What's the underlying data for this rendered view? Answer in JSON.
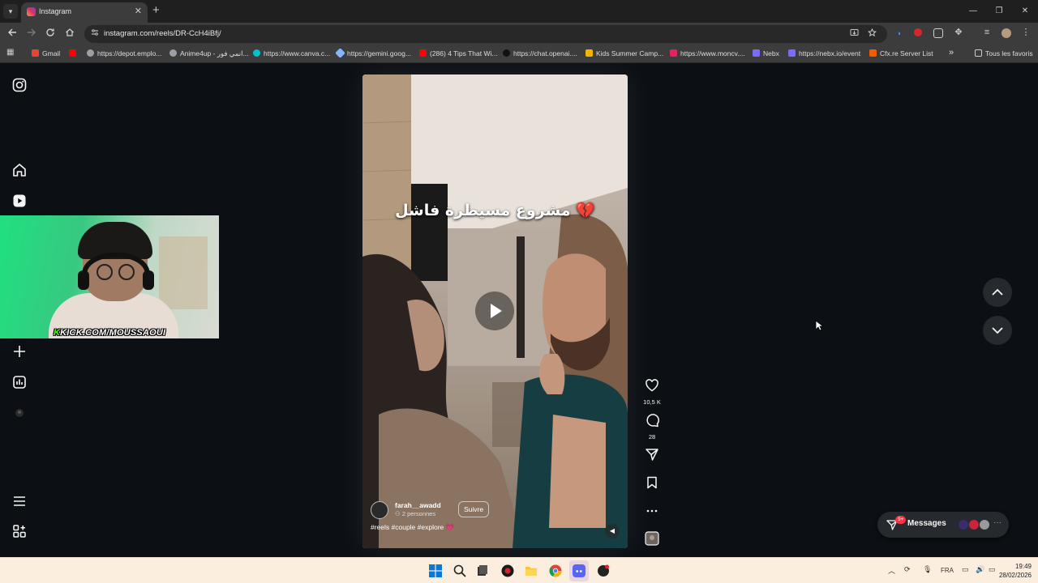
{
  "browser": {
    "tab": {
      "title": "Instagram",
      "close": "✕"
    },
    "new_tab": "+",
    "window_controls": [
      "—",
      "❐",
      "✕"
    ],
    "url": "instagram.com/reels/DR-CcH4iBfj/",
    "bookmarks": [
      {
        "label": "Gmail",
        "icon": "gmail-icon",
        "color": "#ea4335"
      },
      {
        "label": "",
        "icon": "youtube-icon",
        "color": "#ff0000"
      },
      {
        "label": "https://depot.emplo...",
        "icon": "globe-icon",
        "color": "#9aa0a6"
      },
      {
        "label": "Anime4up - انمي فور...",
        "icon": "globe-icon",
        "color": "#9aa0a6"
      },
      {
        "label": "https://www.canva.c...",
        "icon": "canva-icon",
        "color": "#00c4cc"
      },
      {
        "label": "https://gemini.goog...",
        "icon": "gemini-icon",
        "color": "#8ab4f8"
      },
      {
        "label": "(286) 4 Tips That Wi...",
        "icon": "youtube-icon",
        "color": "#ff0000"
      },
      {
        "label": "https://chat.openai....",
        "icon": "openai-icon",
        "color": "#111111"
      },
      {
        "label": "Kids Summer Camp...",
        "icon": "camp-icon",
        "color": "#f4b400"
      },
      {
        "label": "https://www.moncv....",
        "icon": "moncv-icon",
        "color": "#e0245e"
      },
      {
        "label": "Nebx",
        "icon": "nebx-icon",
        "color": "#7b6cf6"
      },
      {
        "label": "https://nebx.io/event",
        "icon": "nebx-icon",
        "color": "#7b6cf6"
      },
      {
        "label": "Cfx.re Server List",
        "icon": "cfx-icon",
        "color": "#f25c05"
      }
    ],
    "bookmarks_overflow": "»",
    "all_bookmarks": "Tous les favoris"
  },
  "webcam": {
    "prefix": "K",
    "text": "KICK.COM/MOUSSAOUI"
  },
  "reel": {
    "caption": "مشروع مسيطرة فاشل 💔",
    "username": "farah__awadd",
    "audience": "2 personnes",
    "follow_label": "Suivre",
    "hashtags": "#reels #couple #explore 💗"
  },
  "actions": {
    "likes": "10,5 K",
    "comments": "28"
  },
  "messages": {
    "label": "Messages",
    "badge": "9+"
  },
  "taskbar": {
    "language": "FRA",
    "time": "19:49",
    "date": "28/02/2026"
  },
  "colors": {
    "page_bg": "#0c1014",
    "accent_red": "#ff3040",
    "kick_green": "#53fc18"
  }
}
